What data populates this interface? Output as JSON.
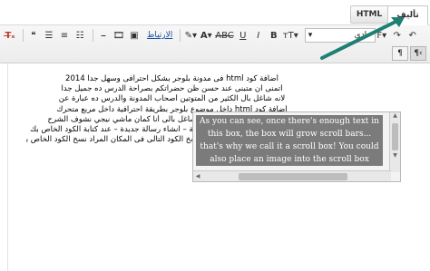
{
  "tabs": {
    "html_label": "HTML",
    "compose_label": "تأليف"
  },
  "toolbar": {
    "font_value": "عادي",
    "link_label": "الارتباط",
    "font_arrow": "▾",
    "text_dir_label": "¶",
    "text_dir_rtl_label": "¶‹"
  },
  "editor": {
    "lines": [
      "أضافة كود html فى مدونة بلوجر بشكل احترافى وسهل جداً 2014",
      "أتمنى ان متبنى عند حسن ظن حضراتكم بصراحة الدرس ده جميل جدا",
      "لانه شاغل بال الكثير من المتوتين أصحاب المدونة والدرس ده عبارة عن",
      "أضافة كود html داخل موضوع بلوجر بطريقة احترافية داخل مربع متحرك",
      "أكيد طبعاً موضوع مهم لانه كان شاغل بالى أنا كمان ماشي نيجي نشوف الشرح",
      "اذهب الى لوحة التحكم الخاصة بالمدونة – انشاء رسالة جديدة – عند كتابة الكود الخاص بك",
      "قم بتحويل وضع الرسالة الى html وانسخ الكود التالى فى المكان المراد نسخ الكود الخاص بالشرح"
    ],
    "scroll_box_text": "As you can see, once there's enough text in this box, the box will grow scroll bars... that's why we call it a scroll box! You could also place an image into the scroll box"
  },
  "colors": {
    "annotation_arrow": "#1e7f73",
    "scroll_highlight": "#7b7b7b"
  }
}
